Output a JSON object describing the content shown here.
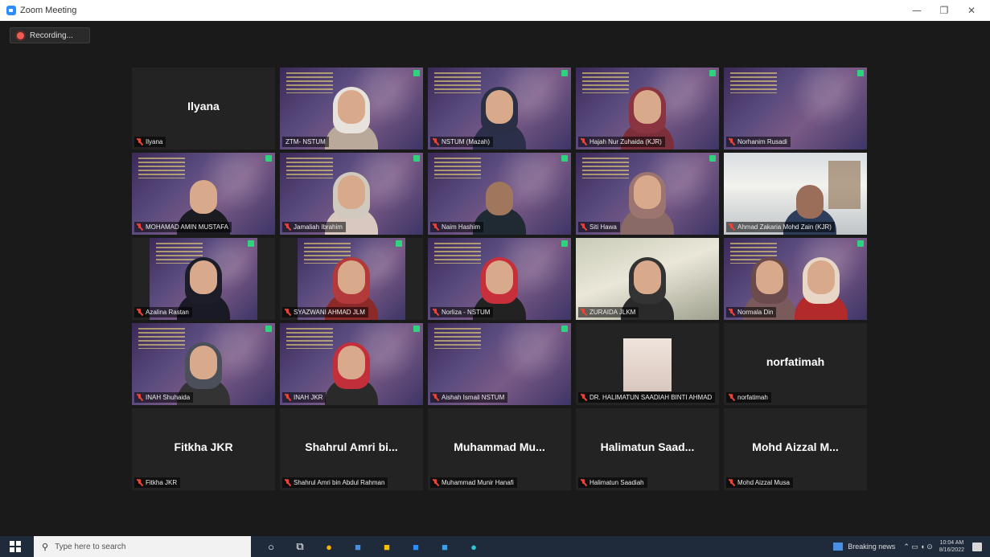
{
  "window": {
    "title": "Zoom Meeting",
    "controls": {
      "minimize": "—",
      "restore": "❐",
      "close": "✕"
    }
  },
  "recording": {
    "label": "Recording..."
  },
  "participants": [
    {
      "name": "Ilyana",
      "label": "Ilyana",
      "video": false
    },
    {
      "label": "ZTM- NSTUM",
      "video": true
    },
    {
      "label": "NSTUM (Mazah)",
      "video": true
    },
    {
      "label": "Hajah Nur Zuhaida (KJR)",
      "video": true
    },
    {
      "label": "Norhanim Rusadi",
      "video": true
    },
    {
      "label": "MOHAMAD AMIN MUSTAFA",
      "video": true
    },
    {
      "label": "Jamaliah Ibrahim",
      "video": true
    },
    {
      "label": "Naim Hashim",
      "video": true
    },
    {
      "label": "Siti Hawa",
      "video": true
    },
    {
      "label": "Ahmad Zakaria Mohd Zain (KJR)",
      "video": true
    },
    {
      "label": "Azalina Rastan",
      "video": true
    },
    {
      "label": "SYAZWANI AHMAD JLM",
      "video": true
    },
    {
      "label": "Norliza - NSTUM",
      "video": true
    },
    {
      "label": "ZURAIDA JLKM",
      "video": true
    },
    {
      "label": "Normala Din",
      "video": true
    },
    {
      "label": "INAH Shuhaida",
      "video": true
    },
    {
      "label": "INAH JKR",
      "video": true
    },
    {
      "label": "Aishah Ismail NSTUM",
      "video": true
    },
    {
      "label": "DR. HALIMATUN SAADIAH BINTI AHMAD",
      "video": true
    },
    {
      "name": "norfatimah",
      "label": "norfatimah",
      "video": false
    },
    {
      "name": "Fitkha JKR",
      "label": "Fitkha JKR",
      "video": false
    },
    {
      "name": "Shahrul Amri bi...",
      "label": "Shahrul Amri bin Abdul Rahman",
      "video": false
    },
    {
      "name": "Muhammad Mu...",
      "label": "Muhammad Munir Hanafi",
      "video": false
    },
    {
      "name": "Halimatun Saad...",
      "label": "Halimatun Saadiah",
      "video": false
    },
    {
      "name": "Mohd Aizzal M...",
      "label": "Mohd Aizzal Musa",
      "video": false
    }
  ],
  "taskbar": {
    "search_placeholder": "Type here to search",
    "news": "Breaking news",
    "time": "10:04 AM",
    "date": "8/16/2022"
  }
}
